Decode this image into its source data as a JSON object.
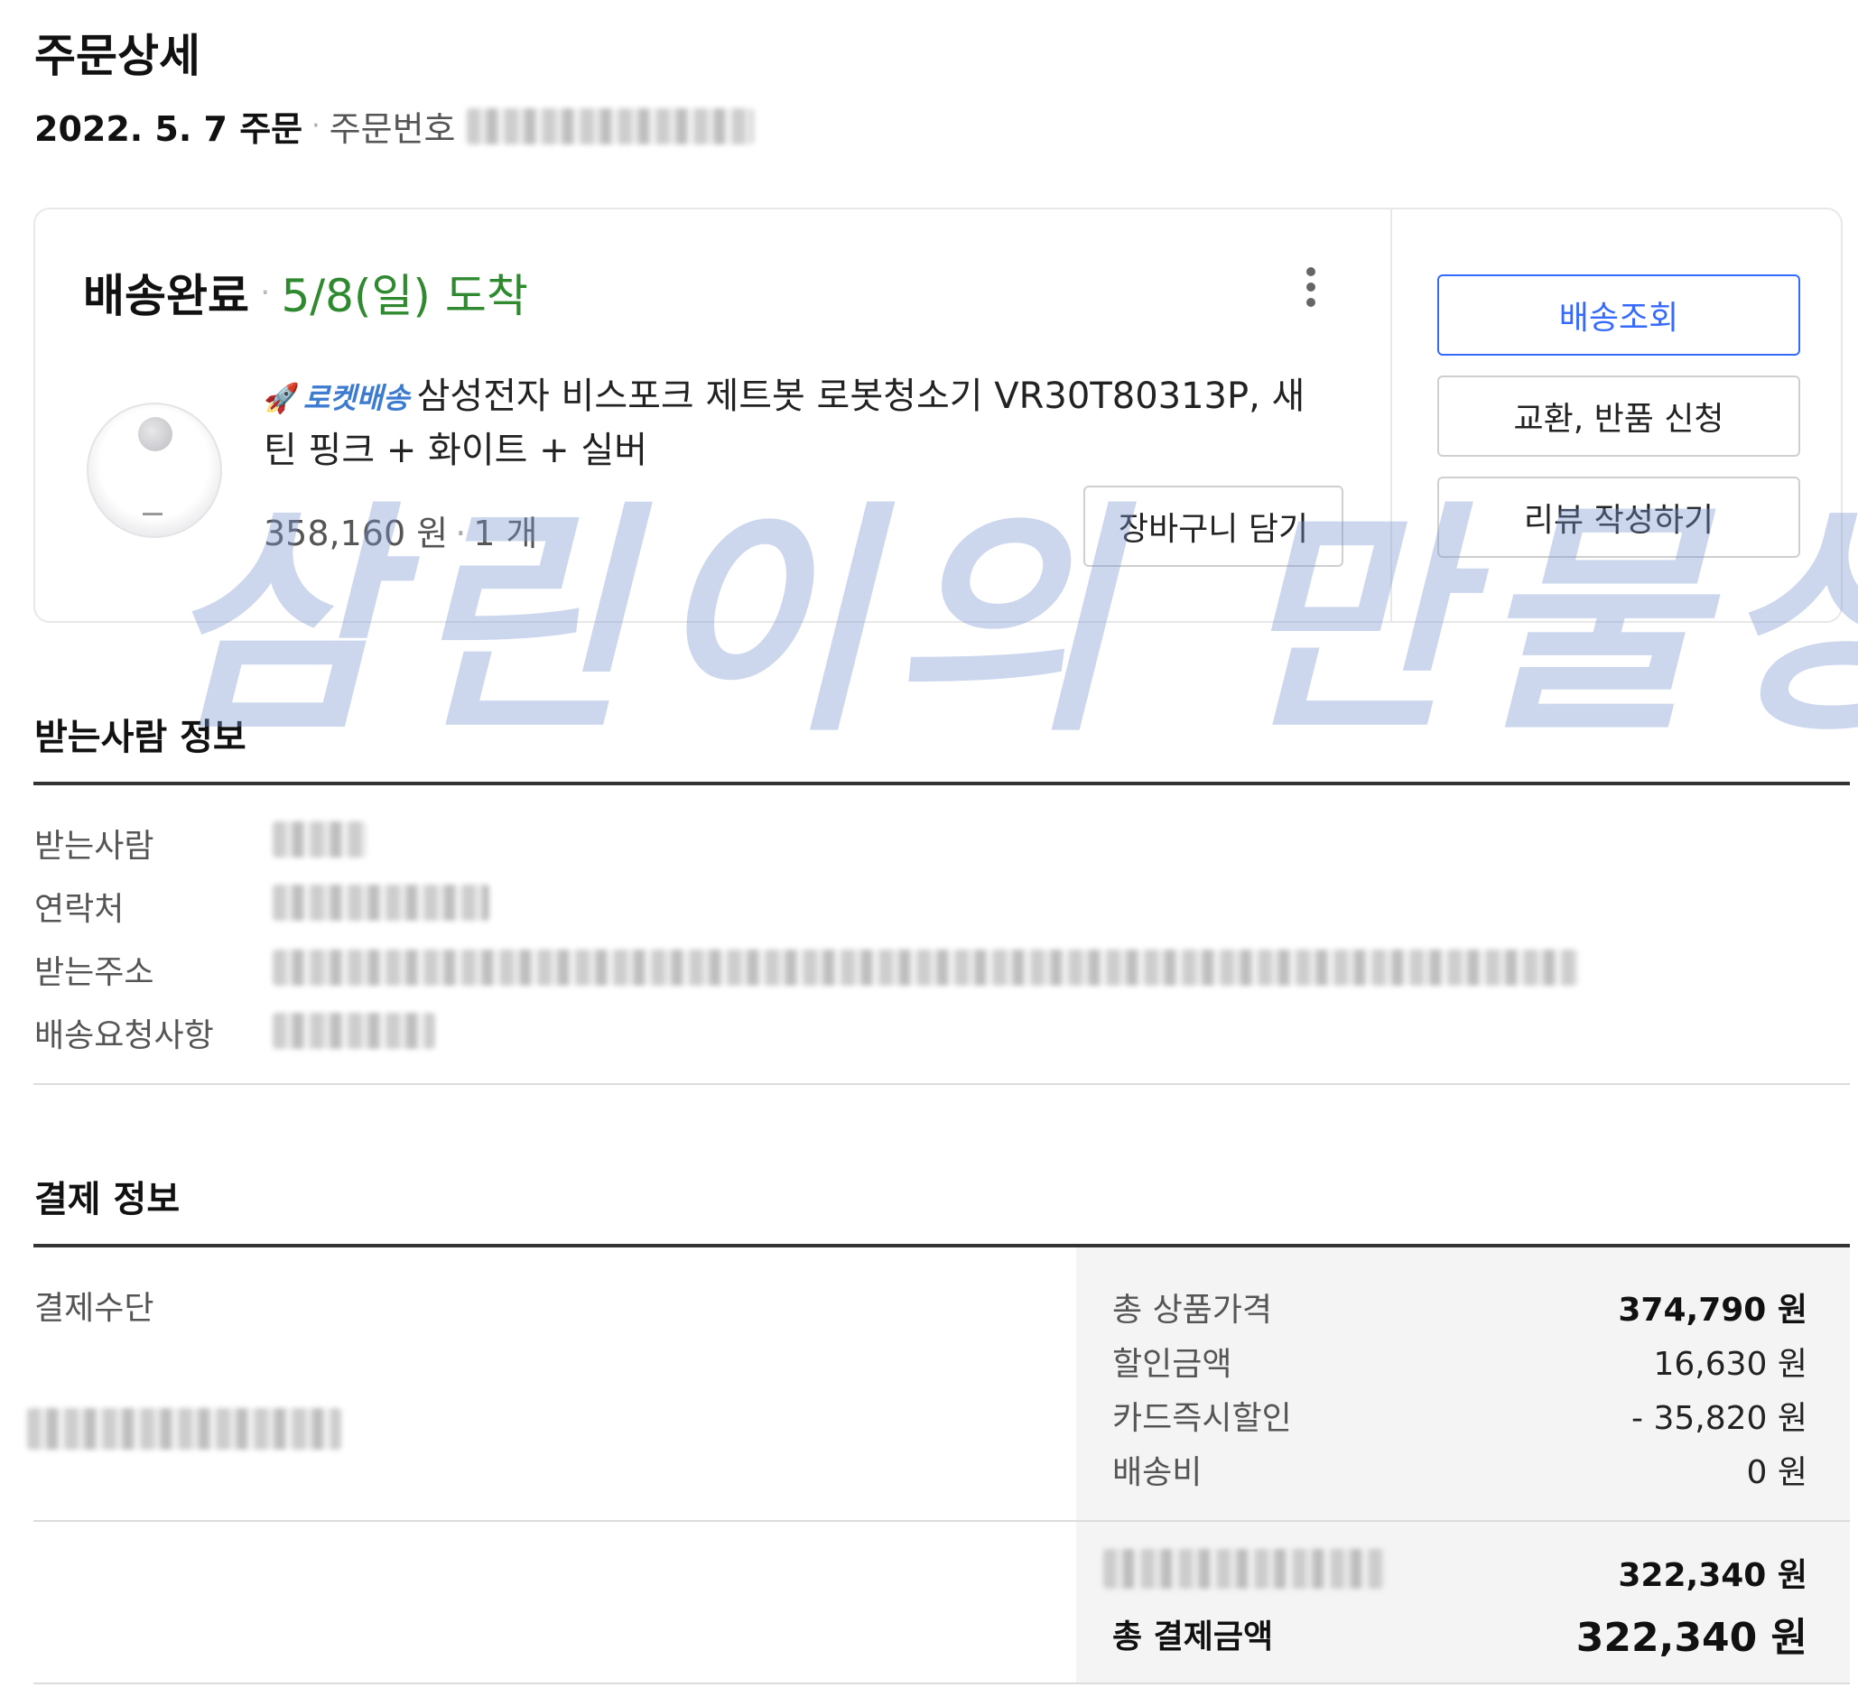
{
  "header": {
    "title": "주문상세",
    "order_date": "2022. 5. 7 주문",
    "order_number_label": "주문번호"
  },
  "shipment": {
    "status": "배송완료",
    "arrival": "5/8(일) 도착",
    "delivery_badge": "로켓배송",
    "product_name": "삼성전자 비스포크 제트봇 로봇청소기 VR30T80313P, 새틴 핑크 + 화이트 + 실버",
    "price": "358,160 원",
    "quantity": "1 개",
    "cart_button": "장바구니 담기",
    "track_button": "배송조회",
    "return_button": "교환, 반품 신청",
    "review_button": "리뷰 작성하기"
  },
  "watermark": "삼린이의 만물상",
  "receiver": {
    "title": "받는사람 정보",
    "rows": [
      {
        "label": "받는사람"
      },
      {
        "label": "연락처"
      },
      {
        "label": "받는주소"
      },
      {
        "label": "배송요청사항"
      }
    ]
  },
  "payment": {
    "title": "결제 정보",
    "method_label": "결제수단",
    "rows": [
      {
        "label": "총 상품가격",
        "value": "374,790 원"
      },
      {
        "label": "할인금액",
        "value": "16,630 원"
      },
      {
        "label": "카드즉시할인",
        "value": "- 35,820 원"
      },
      {
        "label": "배송비",
        "value": "0 원"
      }
    ],
    "card_amount": "322,340 원",
    "total_label": "총 결제금액",
    "total_value": "322,340 원"
  },
  "colors": {
    "accent_blue": "#346aff",
    "arrival_green": "#2f8a2f",
    "rocket_blue": "#3c7bd0"
  }
}
